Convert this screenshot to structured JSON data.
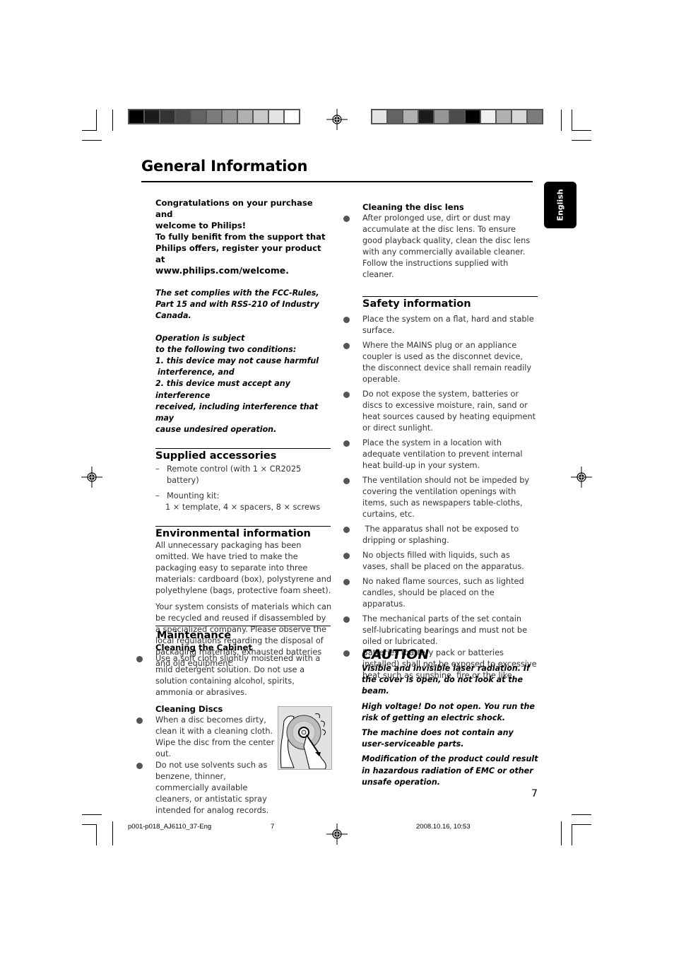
{
  "header": {
    "title": "General Information",
    "language_tab": "English"
  },
  "colors": {
    "left_bar": [
      "#000000",
      "#1b1b1b",
      "#333333",
      "#4b4b4b",
      "#636363",
      "#7c7c7c",
      "#969696",
      "#b0b0b0",
      "#cacaca",
      "#e4e4e4",
      "#ffffff"
    ],
    "right_bar": [
      "#e4e4e4",
      "#636363",
      "#b0b0b0",
      "#1b1b1b",
      "#969696",
      "#4b4b4b",
      "#000000",
      "#f0f0f0",
      "#b0b0b0",
      "#d8d8d8",
      "#7c7c7c"
    ],
    "tab_bg": "#000000",
    "bullet": "#555555"
  },
  "intro": {
    "line1": "Congratulations on your purchase and",
    "line2": "welcome to Philips!",
    "line3": "To fully benifit from the support that",
    "line4": "Philips offers, register your product at",
    "url": "www.philips.com/welcome."
  },
  "fcc": {
    "line1": "The set complies with the FCC-Rules,",
    "line2": "Part 15 and with RSS-210 of Industry",
    "line3": "Canada."
  },
  "operation": {
    "line1": "Operation is subject",
    "line2": "to the following two conditions:",
    "line3": "1. this device may not cause harmful",
    "line4": "interference, and",
    "line5": "2. this device must accept any interference",
    "line6": "received, including interference that may",
    "line7": "cause undesired operation."
  },
  "accessories": {
    "heading": "Supplied accessories",
    "items": [
      {
        "dash": "–",
        "text": "Remote control (with 1 × CR2025 battery)"
      },
      {
        "dash": "–",
        "text": "Mounting kit:",
        "sub": "1 × template, 4 × spacers, 8 × screws"
      }
    ]
  },
  "environment": {
    "heading": "Environmental information",
    "p1": "All unnecessary packaging has been omitted. We have tried to make the packaging easy to separate into three materials: cardboard (box), polystyrene and polyethylene (bags, protective foam sheet).",
    "p2": "Your system consists of materials which can be recycled and reused if disassembled by a specialized company. Please observe the local regulations regarding the disposal of packaging materials, exhausted batteries and old equipment."
  },
  "maintenance": {
    "heading": "Maintenance",
    "cabinet_heading": "Cleaning the Cabinet",
    "cabinet_item": "Use a soft cloth slightly moistened with a mild detergent solution. Do not use a solution containing alcohol, spirits, ammonia or abrasives.",
    "discs_heading": "Cleaning Discs",
    "discs_item1": "When a disc becomes dirty, clean it with a cleaning cloth. Wipe the disc from the center out.",
    "discs_item2": "Do not use solvents such as benzene, thinner, commercially available cleaners, or antistatic spray intended for analog records.",
    "illustration": "disc-cleaning-illustration"
  },
  "lens": {
    "heading": "Cleaning the disc lens",
    "item": "After prolonged use, dirt or dust may accumulate at the disc lens. To ensure good playback quality, clean the disc lens with any commercially available cleaner. Follow the instructions supplied with cleaner."
  },
  "safety": {
    "heading": "Safety information",
    "items": [
      "Place the system on a flat, hard and stable surface.",
      "Where the MAINS plug or an appliance coupler is used as the disconnet device, the disconnect device shall remain readily operable.",
      "Do not expose the system, batteries or discs to excessive moisture, rain, sand or heat sources caused by heating equipment or direct sunlight.",
      "Place the system in a location with adequate ventilation to prevent internal heat build-up in your system.",
      "The ventilation should not be impeded by covering the ventilation openings with items, such as newspapers table-cloths, curtains, etc.",
      " The apparatus shall not be exposed to dripping or splashing.",
      "No objects filled with liquids, such as vases, shall be placed on the apparatus.",
      "No naked flame sources, such as lighted candles, should be placed on the apparatus.",
      "The mechanical parts of the set contain self-lubricating bearings and must not be oiled or lubricated.",
      "Batteries (battery pack or batteries installed) shall not be exposed to excessive heat such as sunshine, fire or the like."
    ]
  },
  "caution": {
    "heading": "CAUTION",
    "p1": "Visible and invisible laser radiation. If the cover is open, do not look at the beam.",
    "p2": "High voltage! Do not open. You run the risk of getting an electric shock.",
    "p3": "The machine does not contain any user-serviceable parts.",
    "p4": "Modification of the product could result in hazardous radiation of EMC or other unsafe operation."
  },
  "page_number": "7",
  "footer": {
    "file": "p001-p018_AJ6110_37-Eng",
    "page": "7",
    "timestamp": "2008.10.16, 10:53"
  }
}
